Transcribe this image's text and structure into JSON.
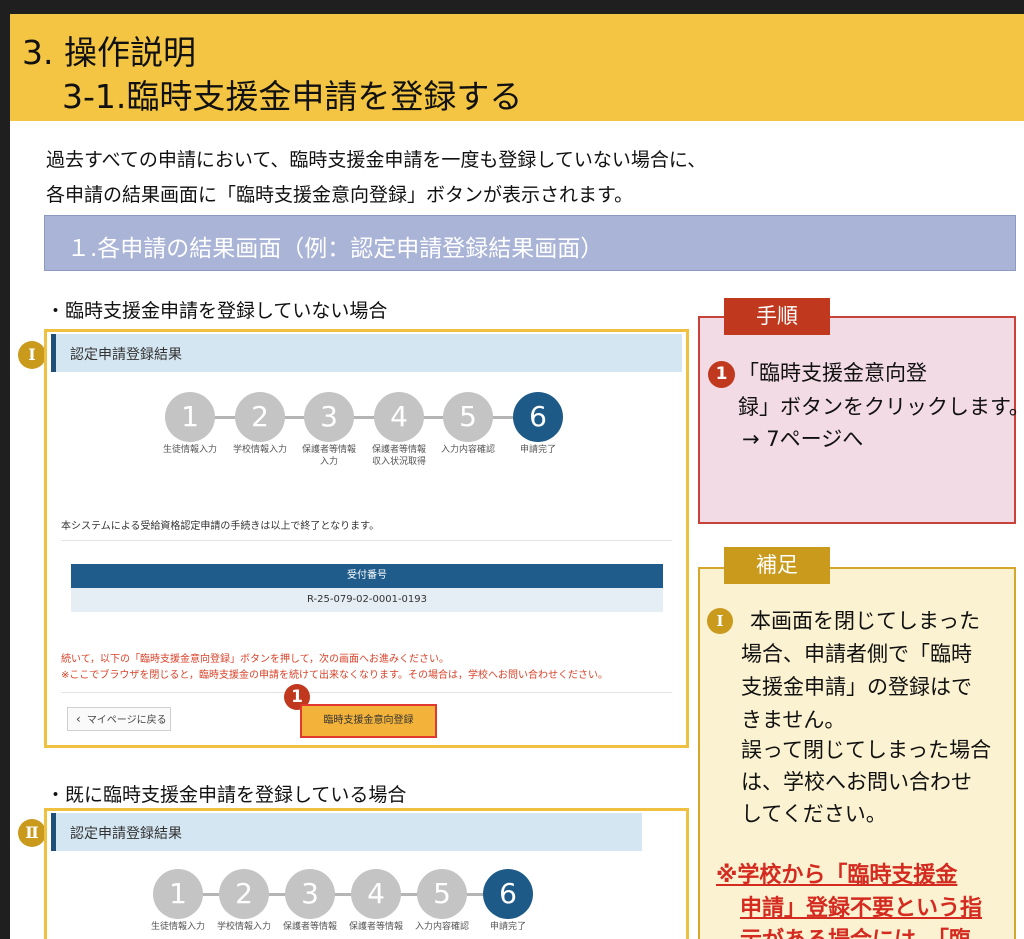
{
  "header": {
    "chapter": "3. 操作説明",
    "title": "3-1.臨時支援金申請を登録する"
  },
  "intro": [
    "過去すべての申請において、臨時支援金申請を一度も登録していない場合に、",
    "各申請の結果画面に「臨時支援金意向登録」ボタンが表示されます。"
  ],
  "section_title": "１.各申請の結果画面（例：認定申請登録結果画面）",
  "case1": {
    "label": "・臨時支援金申請を登録していない場合",
    "marker": "Ⅰ",
    "screen_title": "認定申請登録結果",
    "steps": [
      {
        "num": "1",
        "label": "生徒情報入力"
      },
      {
        "num": "2",
        "label": "学校情報入力"
      },
      {
        "num": "3",
        "label": "保護者等情報\n入力"
      },
      {
        "num": "4",
        "label": "保護者等情報\n収入状況取得"
      },
      {
        "num": "5",
        "label": "入力内容確認"
      },
      {
        "num": "6",
        "label": "申請完了"
      }
    ],
    "done_message": "本システムによる受給資格認定申請の手続きは以上で終了となります。",
    "receipt_label": "受付番号",
    "receipt_value": "R-25-079-02-0001-0193",
    "notice_1": "続いて，以下の「臨時支援金意向登録」ボタンを押して，次の画面へお進みください。",
    "notice_2": "※ここでブラウザを閉じると，臨時支援金の申請を続けて出来なくなります。その場合は，学校へお問い合わせください。",
    "back_button": "マイページに戻る",
    "step_marker": "1",
    "intent_button": "臨時支援金意向登録"
  },
  "case2": {
    "label": "・既に臨時支援金申請を登録している場合",
    "marker": "Ⅱ",
    "screen_title": "認定申請登録結果",
    "steps": [
      {
        "num": "1",
        "label": "生徒情報入力"
      },
      {
        "num": "2",
        "label": "学校情報入力"
      },
      {
        "num": "3",
        "label": "保護者等情報"
      },
      {
        "num": "4",
        "label": "保護者等情報"
      },
      {
        "num": "5",
        "label": "入力内容確認"
      },
      {
        "num": "6",
        "label": "申請完了"
      }
    ]
  },
  "procedure": {
    "tag": "手順",
    "marker": "1",
    "lines": [
      "「臨時支援金意向登",
      "録」ボタンをクリックします。",
      "→  7ページへ"
    ]
  },
  "supplement": {
    "tag": "補足",
    "marker": "Ⅰ",
    "lines": [
      "本画面を閉じてしまった",
      "場合、申請者側で「臨時",
      "支援金申請」の登録はで",
      "きません。",
      "誤って閉じてしまった場合",
      "は、学校へお問い合わせ",
      "してください。"
    ],
    "warning_lines": [
      "※学校から「臨時支援金",
      "申請」登録不要という指",
      "示がある場合には、「臨"
    ]
  },
  "colors": {
    "header": "#f4c542",
    "section_bar": "#a9b4d7",
    "step_active": "#1e5a88",
    "step_inactive": "#c4c4c4",
    "marker_red": "#c0391f",
    "roman_gold": "#c99a1c",
    "warning": "#d42a1f"
  }
}
